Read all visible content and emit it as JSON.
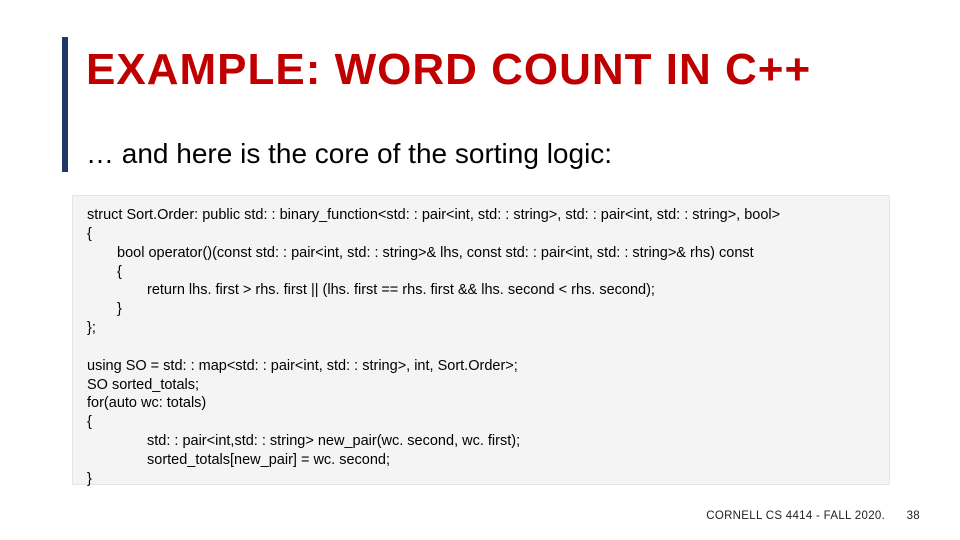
{
  "title": "EXAMPLE: WORD COUNT IN C++",
  "subtitle": "… and here is the core of the sorting logic:",
  "code": {
    "l1": "struct Sort.Order: public std: : binary_function<std: : pair<int, std: : string>, std: : pair<int, std: : string>, bool>",
    "l2": "{",
    "l3": "bool operator()(const std: : pair<int, std: : string>& lhs, const std: : pair<int, std: : string>& rhs) const",
    "l4": "{",
    "l5": "return lhs. first > rhs. first || (lhs. first == rhs. first && lhs. second < rhs. second);",
    "l6": "}",
    "l7": "};",
    "l8": " ",
    "l9": "using SO = std: : map<std: : pair<int, std: : string>, int, Sort.Order>;",
    "l10": "SO sorted_totals;",
    "l11": "for(auto wc: totals)",
    "l12": "{",
    "l13": "std: : pair<int,std: : string> new_pair(wc. second, wc. first);",
    "l14": "sorted_totals[new_pair] = wc. second;",
    "l15": "}"
  },
  "footer": {
    "course": "CORNELL CS 4414 - FALL 2020.",
    "page": "38"
  }
}
